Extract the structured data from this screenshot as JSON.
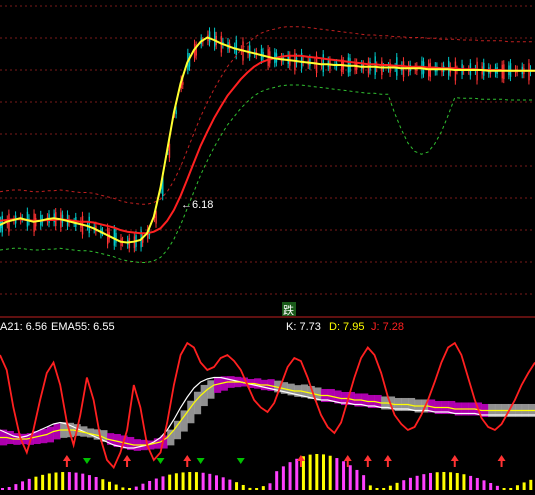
{
  "colors": {
    "background": "#000000",
    "grid": "#7a1a1a",
    "divider": "#c02020",
    "up_candle": "#ff3333",
    "down_candle": "#00c8c8",
    "ma_red": "#ff2020",
    "ma_yellow": "#ffff30",
    "ma_white": "#ffffff",
    "band_dashed": "#c02020",
    "support_dashed": "#30c030",
    "kdj_k": "#ffffff",
    "kdj_d": "#ffff00",
    "kdj_j": "#ff2020",
    "purple_fill": "#c000c0",
    "gray_fill": "#a0a0a0",
    "magenta_bar": "#ff40ff",
    "yellow_bar": "#ffff00",
    "green_marker": "#00c000"
  },
  "main_panel": {
    "low_marker_text": "←6.18",
    "sell_signal": "跌"
  },
  "indicator_header": {
    "ema21": "A21: 6.56",
    "ema55": "EMA55: 6.55",
    "k": "K: 7.73",
    "d": "D: 7.95",
    "j": "J: 7.28"
  },
  "chart_data": [
    {
      "type": "line",
      "panel": "price",
      "title": "",
      "annotations": [
        "←6.18",
        "跌"
      ],
      "x": [
        0,
        2,
        4,
        6,
        8,
        10,
        12,
        14,
        16,
        18,
        20,
        22,
        24,
        26,
        28,
        30,
        32,
        34,
        36,
        38,
        40,
        42,
        44,
        46,
        48,
        50,
        52,
        54,
        56,
        58,
        60,
        62,
        64,
        66,
        68,
        70,
        72,
        74,
        76,
        78,
        80,
        82,
        84,
        86,
        88,
        90,
        92,
        94,
        96,
        98,
        100,
        102,
        104,
        106,
        108,
        110,
        112,
        114,
        116,
        118,
        120,
        122,
        124,
        126,
        128,
        130,
        132,
        134,
        136,
        138,
        140,
        142,
        144,
        146,
        148,
        150,
        152,
        154,
        156,
        158,
        160
      ],
      "series": [
        {
          "name": "",
          "color": "ma_red",
          "values": [
            6.55,
            6.56,
            6.57,
            6.57,
            6.56,
            6.55,
            6.55,
            6.56,
            6.56,
            6.57,
            6.56,
            6.55,
            6.54,
            6.54,
            6.53,
            6.51,
            6.49,
            6.47,
            6.44,
            6.42,
            6.41,
            6.4,
            6.4,
            6.42,
            6.46,
            6.55,
            6.68,
            6.85,
            7.05,
            7.25,
            7.45,
            7.62,
            7.78,
            7.92,
            8.05,
            8.15,
            8.25,
            8.33,
            8.4,
            8.45,
            8.48,
            8.5,
            8.52,
            8.53,
            8.53,
            8.53,
            8.52,
            8.51,
            8.5,
            8.49,
            8.48,
            8.47,
            8.46,
            8.45,
            8.44,
            8.43,
            8.43,
            8.42,
            8.42,
            8.41,
            8.41,
            8.4,
            8.4,
            8.4,
            8.39,
            8.39,
            8.38,
            8.38,
            8.38,
            8.37,
            8.37,
            8.37,
            8.36,
            8.36,
            8.36,
            8.36,
            8.35,
            8.35,
            8.35,
            8.35,
            8.35
          ]
        },
        {
          "name": "",
          "color": "ma_yellow",
          "values": [
            6.5,
            6.54,
            6.56,
            6.58,
            6.56,
            6.54,
            6.55,
            6.57,
            6.58,
            6.57,
            6.55,
            6.53,
            6.51,
            6.49,
            6.46,
            6.42,
            6.38,
            6.34,
            6.3,
            6.29,
            6.3,
            6.32,
            6.4,
            6.6,
            6.95,
            7.4,
            7.85,
            8.2,
            8.45,
            8.6,
            8.7,
            8.75,
            8.72,
            8.68,
            8.65,
            8.62,
            8.6,
            8.58,
            8.56,
            8.54,
            8.52,
            8.5,
            8.49,
            8.48,
            8.47,
            8.46,
            8.45,
            8.44,
            8.43,
            8.43,
            8.42,
            8.42,
            8.41,
            8.41,
            8.4,
            8.4,
            8.4,
            8.39,
            8.39,
            8.39,
            8.38,
            8.38,
            8.38,
            8.38,
            8.37,
            8.37,
            8.37,
            8.37,
            8.36,
            8.36,
            8.36,
            8.36,
            8.36,
            8.35,
            8.35,
            8.35,
            8.35,
            8.35,
            8.35,
            8.35,
            8.35
          ]
        }
      ]
    },
    {
      "type": "line",
      "panel": "indicator",
      "title": "",
      "legend": [
        "A21: 6.56",
        "EMA55: 6.55",
        "K: 7.73",
        "D: 7.95",
        "J: 7.28"
      ],
      "x": [
        0,
        1,
        2,
        3,
        4,
        5,
        6,
        7,
        8,
        9,
        10,
        11,
        12,
        13,
        14,
        15,
        16,
        17,
        18,
        19,
        20,
        21,
        22,
        23,
        24,
        25,
        26,
        27,
        28,
        29,
        30,
        31,
        32,
        33,
        34,
        35,
        36,
        37,
        38,
        39,
        40,
        41,
        42,
        43,
        44,
        45,
        46,
        47,
        48,
        49,
        50,
        51,
        52,
        53,
        54,
        55,
        56,
        57,
        58,
        59,
        60,
        61,
        62,
        63,
        64,
        65,
        66,
        67,
        68,
        69,
        70,
        71,
        72,
        73,
        74,
        75,
        76,
        77,
        78,
        79,
        80
      ],
      "series": [
        {
          "name": "K",
          "color": "kdj_k",
          "values": [
            40,
            38,
            36,
            35,
            36,
            38,
            40,
            42,
            44,
            45,
            44,
            42,
            40,
            38,
            36,
            34,
            32,
            30,
            29,
            28,
            28,
            29,
            30,
            32,
            35,
            40,
            47,
            55,
            62,
            68,
            72,
            74,
            75,
            75,
            74,
            73,
            72,
            71,
            70,
            69,
            68,
            67,
            66,
            65,
            64,
            63,
            62,
            61,
            60,
            60,
            59,
            58,
            58,
            57,
            57,
            56,
            56,
            55,
            55,
            54,
            54,
            54,
            53,
            53,
            53,
            52,
            52,
            52,
            51,
            51,
            51,
            51,
            50,
            50,
            50,
            50,
            50,
            50,
            50,
            50,
            50
          ]
        },
        {
          "name": "D",
          "color": "kdj_d",
          "values": [
            35,
            35,
            34,
            34,
            34,
            35,
            36,
            37,
            39,
            40,
            40,
            40,
            39,
            38,
            37,
            36,
            34,
            33,
            32,
            31,
            30,
            30,
            30,
            31,
            32,
            35,
            40,
            46,
            52,
            58,
            63,
            67,
            70,
            71,
            72,
            72,
            72,
            71,
            71,
            70,
            70,
            69,
            68,
            67,
            66,
            66,
            65,
            64,
            63,
            63,
            62,
            61,
            61,
            60,
            60,
            59,
            59,
            58,
            58,
            57,
            57,
            57,
            56,
            56,
            56,
            55,
            55,
            55,
            54,
            54,
            54,
            54,
            53,
            53,
            53,
            53,
            53,
            53,
            53,
            53,
            53
          ]
        },
        {
          "name": "J",
          "color": "kdj_j",
          "values": [
            90,
            80,
            55,
            35,
            25,
            40,
            60,
            78,
            85,
            70,
            45,
            30,
            50,
            75,
            60,
            35,
            20,
            15,
            25,
            40,
            70,
            55,
            30,
            20,
            25,
            45,
            70,
            90,
            98,
            95,
            85,
            80,
            82,
            88,
            90,
            86,
            80,
            70,
            60,
            55,
            52,
            58,
            70,
            82,
            88,
            86,
            75,
            62,
            50,
            42,
            38,
            45,
            60,
            75,
            88,
            95,
            90,
            78,
            62,
            50,
            44,
            40,
            42,
            50,
            60,
            72,
            85,
            95,
            98,
            90,
            75,
            60,
            48,
            42,
            40,
            44,
            52,
            60,
            70,
            78,
            85
          ]
        }
      ]
    }
  ]
}
